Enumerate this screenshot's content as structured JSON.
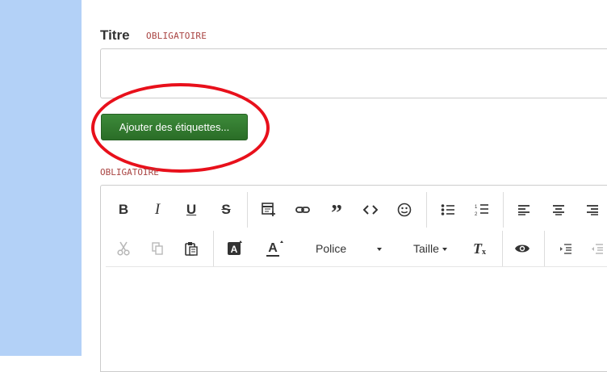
{
  "form": {
    "title_label": "Titre",
    "title_required": "OBLIGATOIRE",
    "tags_button": "Ajouter des étiquettes...",
    "body_required": "OBLIGATOIRE"
  },
  "editor": {
    "row1": [
      {
        "name": "bold-icon",
        "glyph": "B"
      },
      {
        "name": "italic-icon",
        "glyph": "I"
      },
      {
        "name": "underline-icon",
        "glyph": "U"
      },
      {
        "name": "strikethrough-icon",
        "glyph": "S"
      },
      {
        "name": "insert-table-icon"
      },
      {
        "name": "link-icon"
      },
      {
        "name": "blockquote-icon"
      },
      {
        "name": "code-icon"
      },
      {
        "name": "emoji-icon"
      },
      {
        "name": "bullet-list-icon"
      },
      {
        "name": "numbered-list-icon"
      },
      {
        "name": "align-left-icon"
      },
      {
        "name": "align-center-icon"
      },
      {
        "name": "align-right-icon"
      }
    ],
    "font_dropdown": "Police",
    "size_dropdown": "Taille",
    "colors": {
      "accent_green": "#2f7a2c",
      "required_red": "#a94442",
      "annotation_red": "#e8101b",
      "sidebar_blue": "#b3d1f7"
    }
  }
}
